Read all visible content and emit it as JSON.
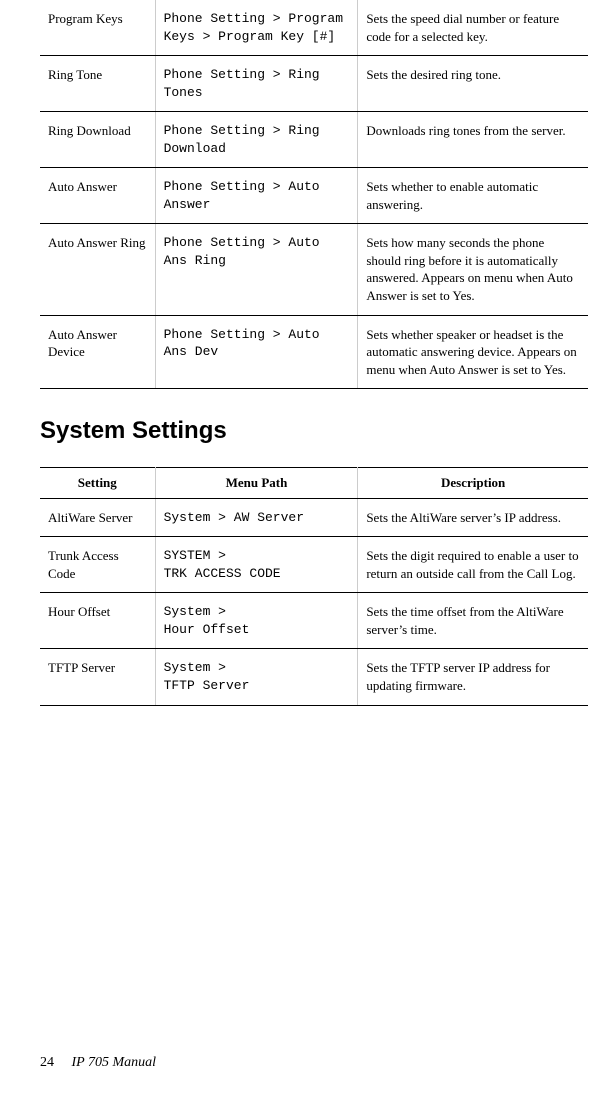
{
  "table1": {
    "rows": [
      {
        "setting": "Program Keys",
        "path": "Phone Setting > Program Keys > Program Key [#]",
        "desc": "Sets the speed dial number or feature code for a selected key."
      },
      {
        "setting": "Ring Tone",
        "path": "Phone Setting > Ring Tones",
        "desc": "Sets the desired ring tone."
      },
      {
        "setting": "Ring Download",
        "path": "Phone Setting > Ring Download",
        "desc": "Downloads ring tones from the server."
      },
      {
        "setting": "Auto Answer",
        "path": "Phone Setting > Auto Answer",
        "desc": "Sets whether to enable automatic answering."
      },
      {
        "setting": "Auto Answer Ring",
        "path": "Phone Setting > Auto Ans Ring",
        "desc": "Sets how many seconds the phone should ring before it is automatically answered. Appears on menu when Auto Answer is set to Yes."
      },
      {
        "setting": "Auto Answer Device",
        "path": "Phone Setting > Auto Ans Dev",
        "desc": "Sets whether speaker or headset is the automatic answering device. Appears on menu when Auto Answer is set to Yes."
      }
    ]
  },
  "section_heading": "System Settings",
  "table2": {
    "headers": {
      "setting": "Setting",
      "path": "Menu Path",
      "desc": "Description"
    },
    "rows": [
      {
        "setting": "AltiWare Server",
        "path": "System > AW Server",
        "desc": "Sets the AltiWare server’s IP address."
      },
      {
        "setting": "Trunk Access Code",
        "path": "SYSTEM >\nTRK ACCESS CODE",
        "desc": "Sets the digit required to enable a user to return an outside call from the Call Log."
      },
      {
        "setting": "Hour Offset",
        "path": "System >\nHour Offset",
        "desc": "Sets the time offset from the AltiWare server’s time."
      },
      {
        "setting": "TFTP Server",
        "path": "System >\nTFTP Server",
        "desc": "Sets the TFTP server IP address for updating firmware."
      }
    ]
  },
  "footer": {
    "page": "24",
    "manual": "IP 705 Manual"
  }
}
